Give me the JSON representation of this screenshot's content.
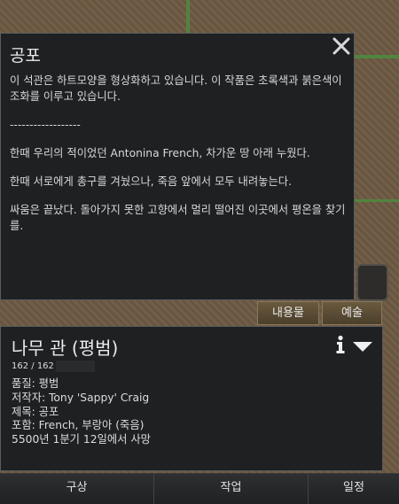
{
  "artwork": {
    "title": "공포",
    "description": "이 석관은 하트모양을 형상화하고 있습니다. 이 작품은 초록색과 붉은색이 조화를 이루고 있습니다.",
    "separator": "------------------",
    "tale_1": "한때 우리의 적이었던 Antonina French, 차가운 땅 아래 누웠다.",
    "tale_2": "한때 서로에게 총구를 겨눴으나, 죽음 앞에서 모두 내려놓는다.",
    "tale_3": "싸움은 끝났다. 돌아가지 못한 고향에서 멀리 떨어진 이곳에서 평온을 찾기를."
  },
  "tabs": {
    "contents": "내용물",
    "art": "예술"
  },
  "inspect": {
    "title": "나무 관 (평범)",
    "hp": "162 / 162",
    "quality": "품질: 평범",
    "author": "저작자: Tony 'Sappy' Craig",
    "art_title": "제목: 공포",
    "contains": "포함: French, 부랑아 (죽음)",
    "death": "5500년 1분기 12일에서 사망"
  },
  "bottom_bar": {
    "architect": "구상",
    "work": "작업",
    "schedule": "일정"
  },
  "icons": {
    "close": "close-icon",
    "info": "info-icon",
    "menu": "dropdown-icon"
  },
  "colors": {
    "panel": "#1e2022",
    "tab_button": "#5b4d36",
    "map_soil": "#6e5a43",
    "grass": "#4d8a3e"
  }
}
